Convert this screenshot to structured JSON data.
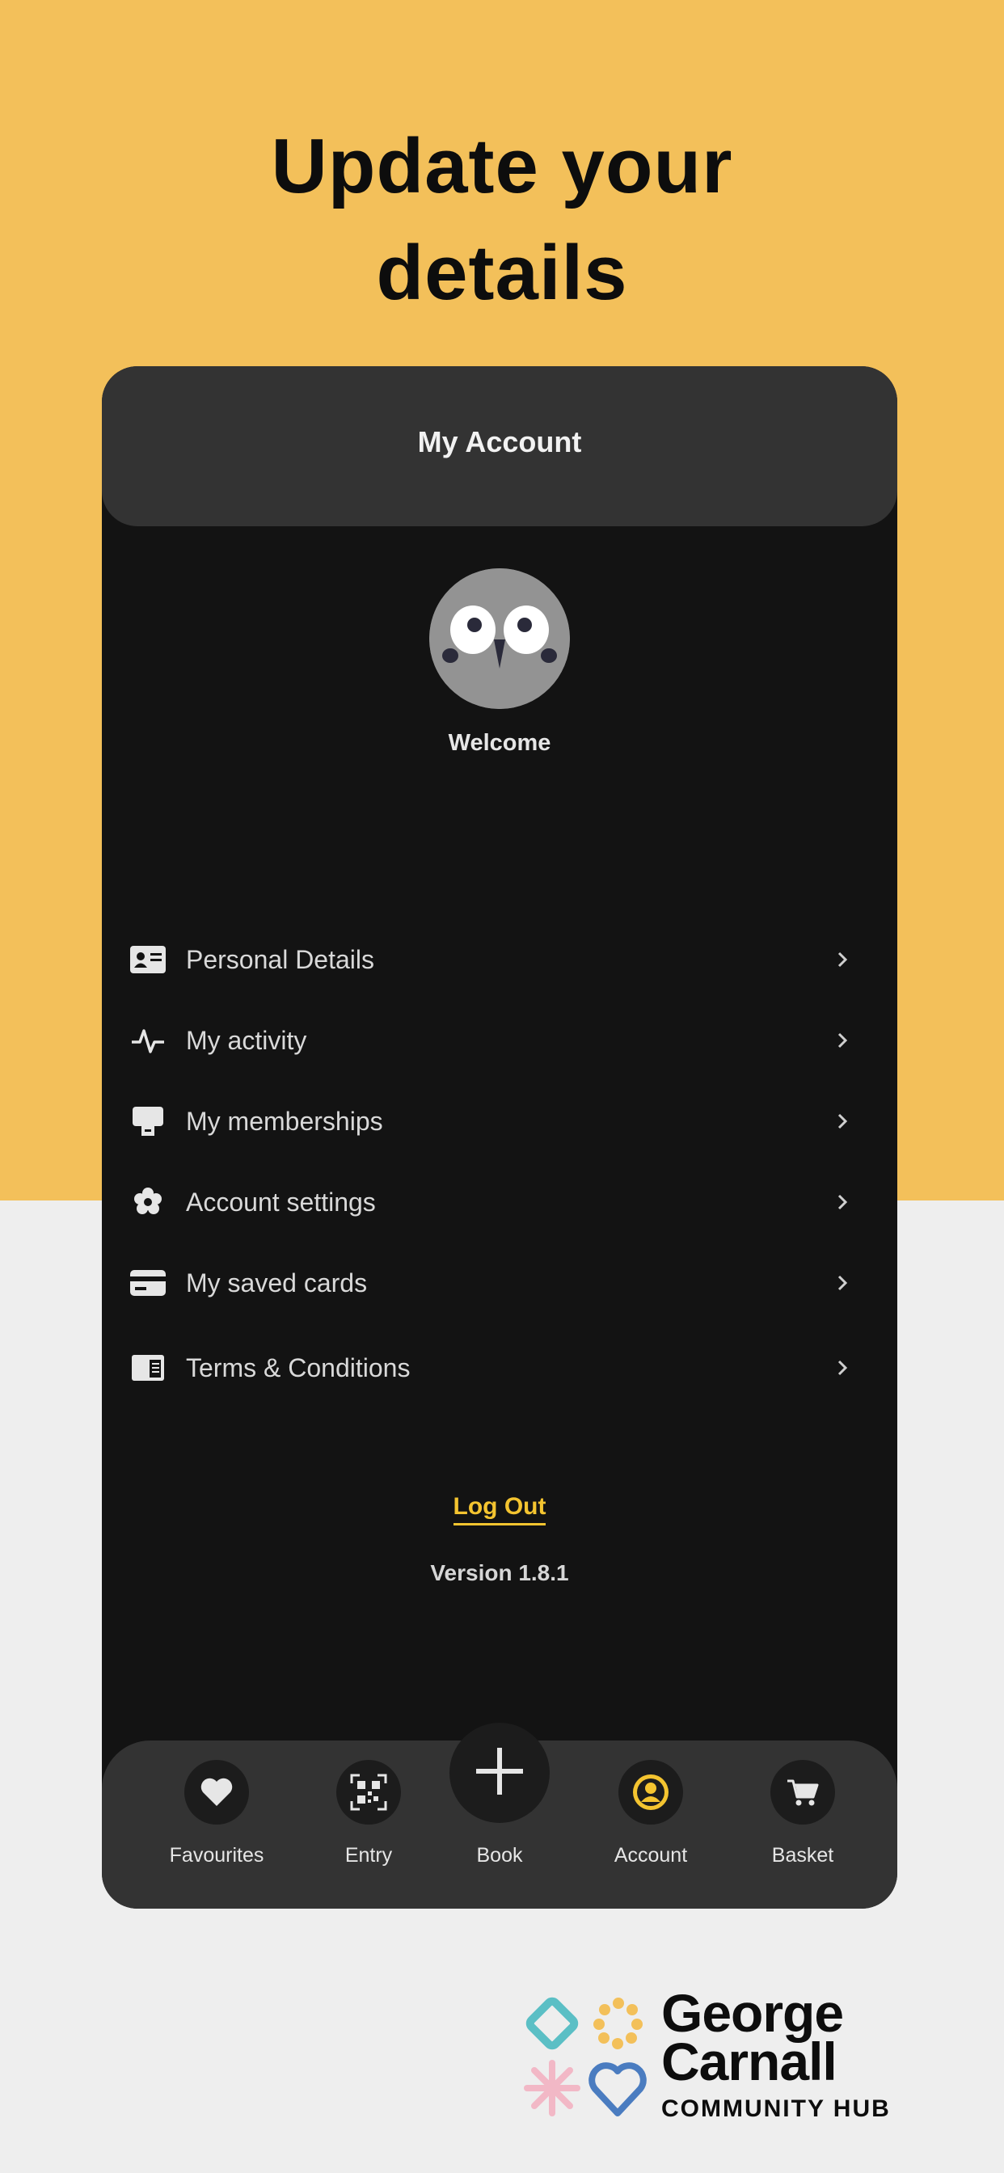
{
  "headline": {
    "line1": "Update your",
    "line2": "details"
  },
  "app": {
    "header_title": "My Account",
    "welcome": "Welcome",
    "menu": [
      {
        "label": "Personal Details",
        "icon": "id-card-icon"
      },
      {
        "label": "My activity",
        "icon": "activity-icon"
      },
      {
        "label": "My memberships",
        "icon": "membership-card-icon"
      },
      {
        "label": "Account settings",
        "icon": "settings-gear-icon"
      },
      {
        "label": "My saved cards",
        "icon": "credit-card-icon"
      },
      {
        "label": "Terms & Conditions",
        "icon": "document-icon"
      }
    ],
    "logout_label": "Log Out",
    "version": "Version 1.8.1",
    "tabs": [
      {
        "label": "Favourites",
        "icon": "heart-icon"
      },
      {
        "label": "Entry",
        "icon": "qr-code-icon"
      },
      {
        "label": "Book",
        "icon": "plus-icon"
      },
      {
        "label": "Account",
        "icon": "user-circle-icon",
        "active": true
      },
      {
        "label": "Basket",
        "icon": "cart-icon"
      }
    ]
  },
  "brand": {
    "line1": "George",
    "line2": "Carnall",
    "line3": "COMMUNITY HUB"
  },
  "colors": {
    "top_background": "#f3c05a",
    "bottom_background": "#eeeeee",
    "phone_background": "#131313",
    "panel": "#333333",
    "accent": "#f4c430"
  }
}
